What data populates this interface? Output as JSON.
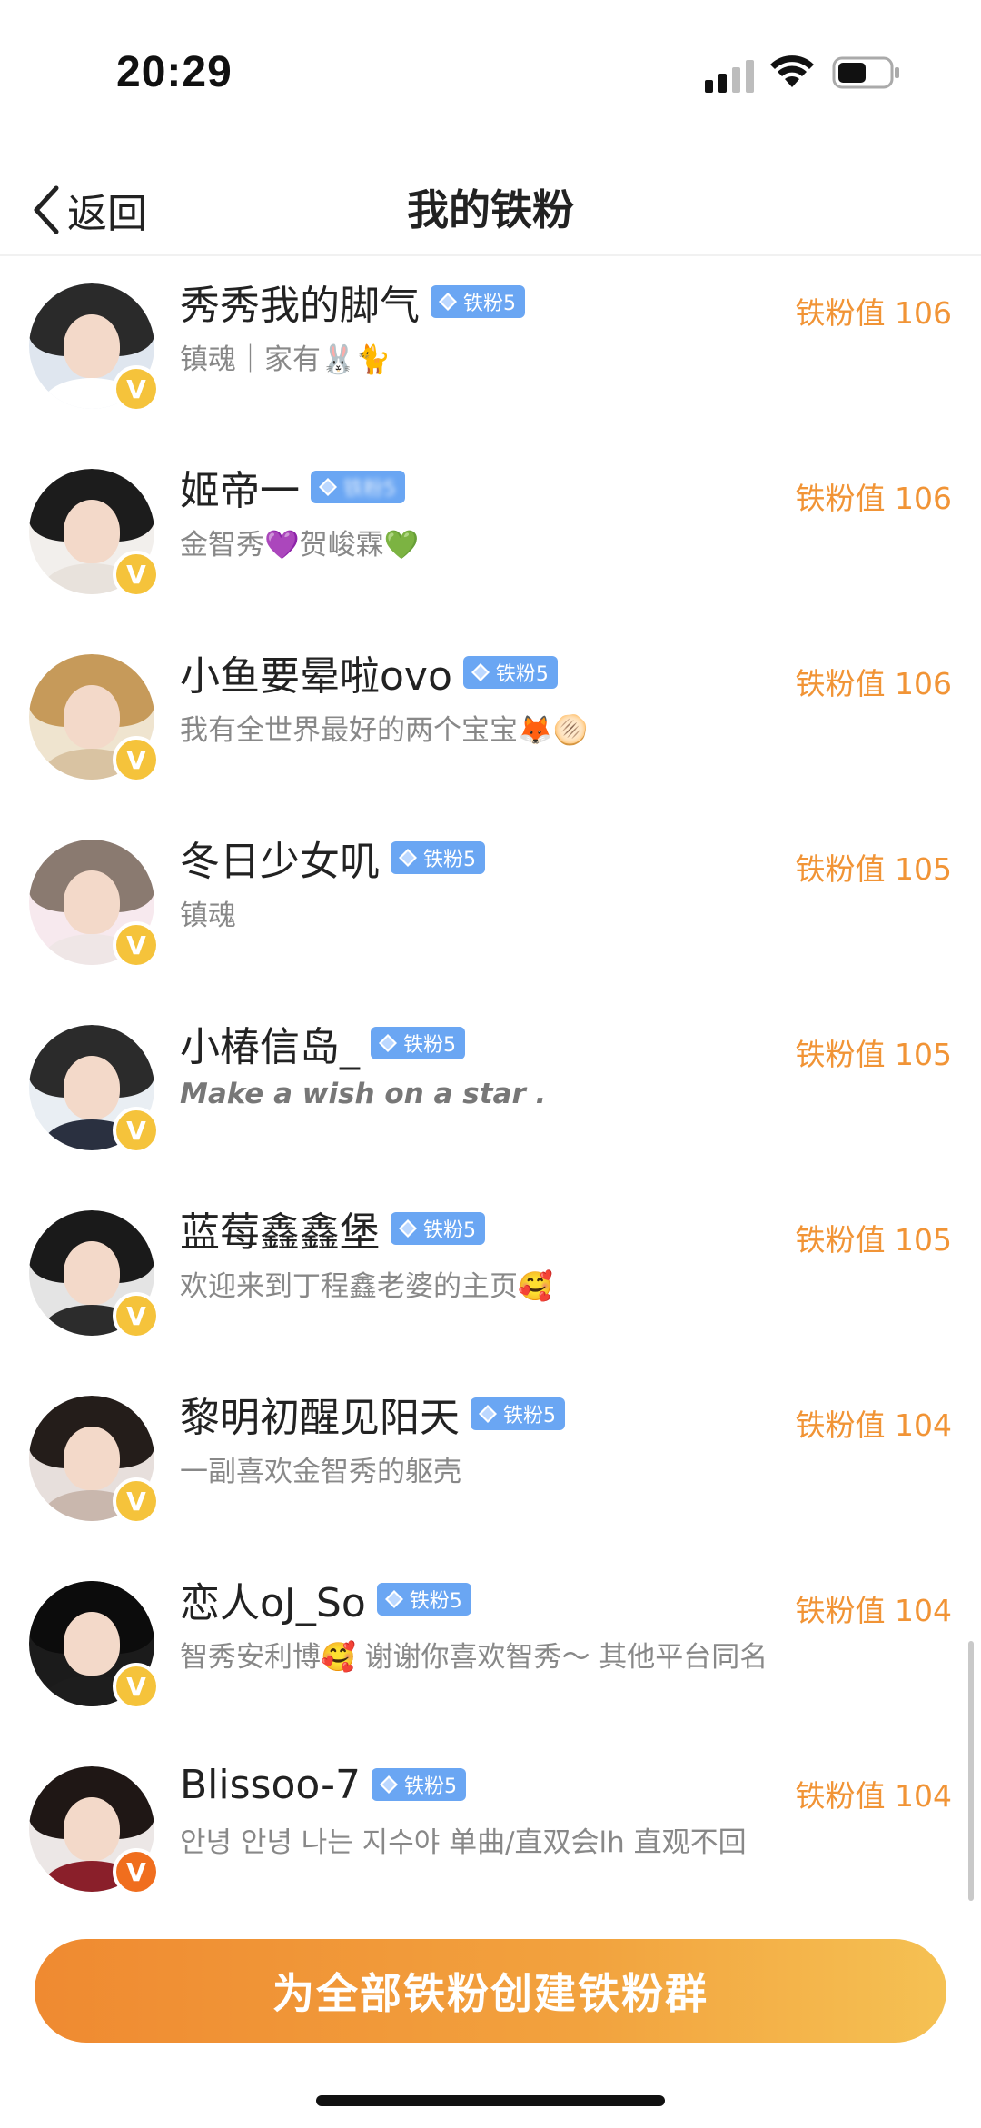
{
  "status": {
    "time": "20:29"
  },
  "nav": {
    "back_label": "返回",
    "title": "我的铁粉"
  },
  "fans": [
    {
      "name": "秀秀我的脚气",
      "badge": "铁粉5",
      "desc": "镇魂｜家有🐰🐈",
      "score": "铁粉值 106",
      "desc_style": "normal",
      "hair": "#2a2a2a",
      "body": "#ffffff",
      "bg": "#dfe6ef",
      "badge_blur": false,
      "v_color": "yellow"
    },
    {
      "name": "姬帝一",
      "badge": "铁粉5",
      "desc": "金智秀💜贺峻霖💚",
      "score": "铁粉值 106",
      "desc_style": "normal",
      "hair": "#1c1c1c",
      "body": "#e8e2dc",
      "bg": "#f2efec",
      "badge_blur": true,
      "v_color": "yellow"
    },
    {
      "name": "小鱼要晕啦ovo",
      "badge": "铁粉5",
      "desc": "我有全世界最好的两个宝宝🦊🫓",
      "score": "铁粉值 106",
      "desc_style": "normal",
      "hair": "#c69a5a",
      "body": "#d9c3a2",
      "bg": "#efe4cf",
      "badge_blur": false,
      "v_color": "yellow"
    },
    {
      "name": "冬日少女叽",
      "badge": "铁粉5",
      "desc": "镇魂",
      "score": "铁粉值 105",
      "desc_style": "normal",
      "hair": "#8a7a70",
      "body": "#efe6e6",
      "bg": "#f7e9ee",
      "badge_blur": false,
      "v_color": "yellow"
    },
    {
      "name": "小椿信岛_",
      "badge": "铁粉5",
      "desc": "Make a wish on a star .",
      "score": "铁粉值 105",
      "desc_style": "italic",
      "hair": "#2b2b2b",
      "body": "#2a3040",
      "bg": "#e9eef3",
      "badge_blur": false,
      "v_color": "yellow"
    },
    {
      "name": "蓝莓鑫鑫堡",
      "badge": "铁粉5",
      "desc": "欢迎来到丁程鑫老婆的主页🥰",
      "score": "铁粉值 105",
      "desc_style": "normal",
      "hair": "#1a1a1a",
      "body": "#2c2c2c",
      "bg": "#e4e4e4",
      "badge_blur": false,
      "v_color": "yellow"
    },
    {
      "name": "黎明初醒见阳天",
      "badge": "铁粉5",
      "desc": "一副喜欢金智秀的躯壳",
      "score": "铁粉值 104",
      "desc_style": "normal",
      "hair": "#241d1a",
      "body": "#c9b7ad",
      "bg": "#e7dfdc",
      "badge_blur": false,
      "v_color": "yellow"
    },
    {
      "name": "恋人oJ_So",
      "badge": "铁粉5",
      "desc": "智秀安利博🥰 谢谢你喜欢智秀～ 其他平台同名",
      "score": "铁粉值 104",
      "desc_style": "normal",
      "hair": "#0c0c0c",
      "body": "#1d1d1d",
      "bg": "#1b1b1b",
      "badge_blur": false,
      "v_color": "yellow"
    },
    {
      "name": "Blissoo-7",
      "badge": "铁粉5",
      "desc": "안녕 안녕 나는 지수야 单曲/直双会lh 直观不回",
      "score": "铁粉值 104",
      "desc_style": "normal",
      "hair": "#1f1715",
      "body": "#8a1f2a",
      "bg": "#ece7e6",
      "badge_blur": false,
      "v_color": "orange"
    }
  ],
  "cta_label": "为全部铁粉创建铁粉群"
}
